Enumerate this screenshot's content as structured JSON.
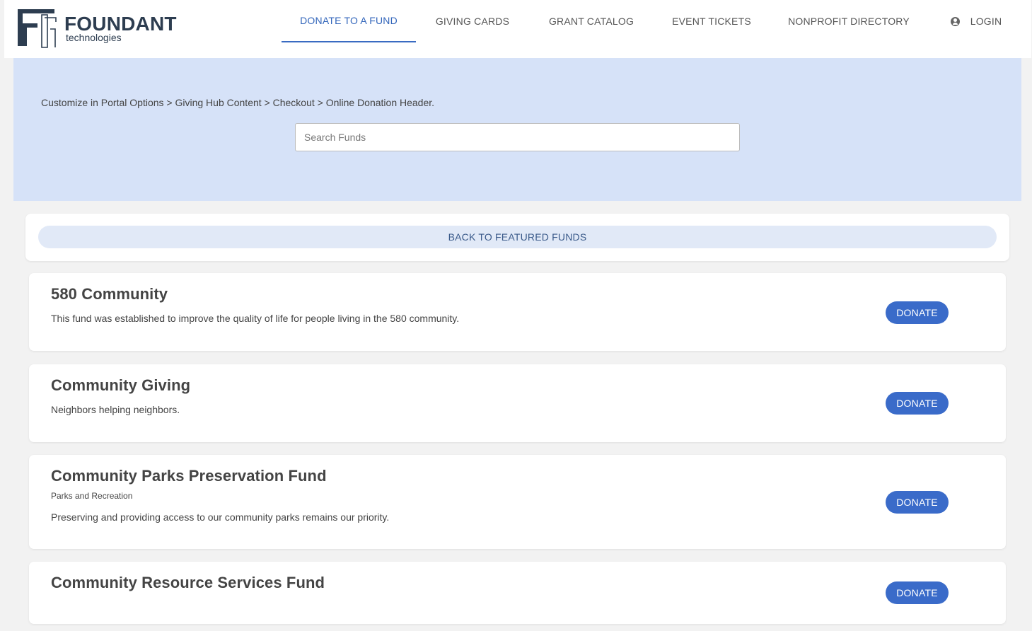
{
  "brand": {
    "name": "FOUNDANT",
    "tagline": "technologies",
    "color": "#2d3d50"
  },
  "nav": {
    "items": [
      {
        "label": "DONATE TO A FUND",
        "active": true
      },
      {
        "label": "GIVING CARDS",
        "active": false
      },
      {
        "label": "GRANT CATALOG",
        "active": false
      },
      {
        "label": "EVENT TICKETS",
        "active": false
      },
      {
        "label": "NONPROFIT DIRECTORY",
        "active": false
      }
    ],
    "login": {
      "label": "LOGIN",
      "icon": "user-circle-icon"
    }
  },
  "hero": {
    "header_text": "Customize in Portal Options > Giving Hub Content > Checkout > Online Donation Header.",
    "search_placeholder": "Search Funds",
    "search_value": "",
    "background": "#d6e2f8"
  },
  "back": {
    "label": "BACK TO FEATURED FUNDS"
  },
  "funds": [
    {
      "title": "580 Community",
      "category": "",
      "description": "This fund was established to improve the quality of life for people living in the 580 community.",
      "button": "DONATE"
    },
    {
      "title": "Community Giving",
      "category": "",
      "description": "Neighbors helping neighbors.",
      "button": "DONATE"
    },
    {
      "title": "Community Parks Preservation Fund",
      "category": "Parks and Recreation",
      "description": "Preserving and providing access to our community parks remains our priority.",
      "button": "DONATE"
    },
    {
      "title": "Community Resource Services Fund",
      "category": "",
      "description": "",
      "button": "DONATE"
    }
  ],
  "colors": {
    "accent": "#3a6bc9",
    "nav_active": "#3366bb",
    "page_bg": "#f2f2f2"
  }
}
